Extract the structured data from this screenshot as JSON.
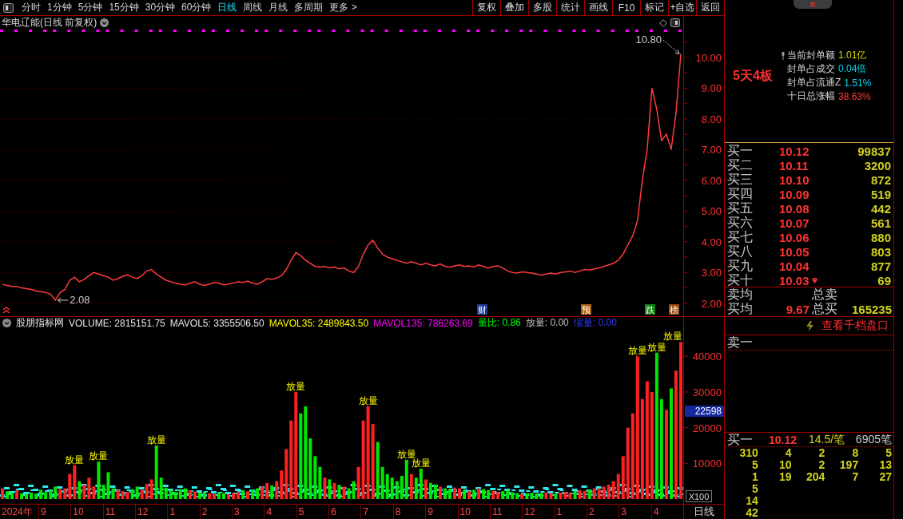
{
  "toolbar": {
    "period_tabs": [
      {
        "label": "分时",
        "selected": false
      },
      {
        "label": "1分钟",
        "selected": false
      },
      {
        "label": "5分钟",
        "selected": false
      },
      {
        "label": "15分钟",
        "selected": false
      },
      {
        "label": "30分钟",
        "selected": false
      },
      {
        "label": "60分钟",
        "selected": false
      },
      {
        "label": "日线",
        "selected": true
      },
      {
        "label": "周线",
        "selected": false
      },
      {
        "label": "月线",
        "selected": false
      },
      {
        "label": "多周期",
        "selected": false
      },
      {
        "label": "更多 >",
        "selected": false
      }
    ],
    "buttons": [
      "复权",
      "叠加",
      "多股",
      "统计",
      "画线",
      "F10",
      "标记",
      "+自选",
      "返回"
    ]
  },
  "price_chart": {
    "title": "华电辽能(日线 前复权)",
    "events": [
      {
        "text": "财",
        "color": "#1c3c9c"
      },
      {
        "text": "预",
        "color": "#b0600c"
      },
      {
        "text": "跌",
        "color": "#0a820a"
      },
      {
        "text": "榜",
        "color": "#9a4a10"
      }
    ],
    "chart_data": {
      "type": "line",
      "grid": true,
      "ylim": [
        1.58,
        10.83
      ],
      "yticks": [
        {
          "value": 2,
          "label": "2.00"
        },
        {
          "value": 3,
          "label": "3.00"
        },
        {
          "value": 4,
          "label": "4.00"
        },
        {
          "value": 5,
          "label": "5.00"
        },
        {
          "value": 6,
          "label": "6.00"
        },
        {
          "value": 7,
          "label": "7.00"
        },
        {
          "value": 8,
          "label": "8.00"
        },
        {
          "value": 9,
          "label": "9.00"
        },
        {
          "value": 10,
          "label": "10.00"
        }
      ],
      "categories": [
        null,
        null,
        null,
        null,
        null,
        null,
        null,
        null,
        null,
        null,
        null,
        null,
        null,
        null,
        null,
        null,
        null,
        null,
        null,
        null,
        null,
        null,
        null,
        null,
        null,
        null,
        null,
        null,
        null,
        null,
        null,
        null,
        null,
        null,
        null,
        null,
        null,
        null,
        null,
        null,
        null,
        null,
        null,
        null,
        null,
        null,
        null,
        null,
        null,
        null,
        null,
        null,
        null,
        null,
        null,
        null,
        null,
        null,
        null,
        null,
        null,
        null,
        null,
        null,
        null,
        null,
        null,
        null,
        null,
        null,
        null,
        null,
        null,
        null,
        null,
        null,
        null,
        null,
        null,
        null,
        null,
        null,
        null,
        null,
        null,
        null,
        null,
        null,
        null,
        null,
        null,
        null,
        null,
        null,
        null,
        null,
        null,
        null,
        null,
        null,
        null,
        null,
        null,
        null,
        null,
        null,
        null,
        null,
        null,
        null,
        null,
        null,
        null,
        null,
        null,
        null,
        null,
        null,
        null,
        null,
        null,
        null,
        null,
        null,
        null,
        null,
        null,
        null,
        null,
        null,
        null,
        null,
        null,
        null,
        null,
        null,
        null,
        null,
        null,
        null,
        null,
        null
      ],
      "series": [
        {
          "color": "#ff3b3b",
          "values": [
            2.62,
            2.58,
            2.55,
            2.55,
            2.5,
            2.48,
            2.45,
            2.4,
            2.38,
            2.35,
            2.3,
            2.1,
            2.35,
            2.45,
            2.75,
            2.85,
            2.7,
            2.78,
            2.9,
            3.0,
            2.95,
            2.9,
            2.85,
            2.75,
            2.8,
            2.88,
            2.92,
            2.85,
            2.8,
            2.9,
            3.05,
            3.1,
            2.95,
            2.85,
            2.75,
            2.7,
            2.65,
            2.62,
            2.6,
            2.65,
            2.7,
            2.62,
            2.58,
            2.62,
            2.68,
            2.65,
            2.6,
            2.62,
            2.66,
            2.7,
            2.68,
            2.72,
            2.65,
            2.62,
            2.7,
            2.8,
            2.78,
            2.82,
            2.9,
            3.1,
            3.4,
            3.65,
            3.55,
            3.4,
            3.3,
            3.2,
            3.18,
            3.2,
            3.15,
            3.18,
            3.12,
            3.15,
            3.05,
            3.0,
            3.2,
            3.6,
            3.9,
            4.05,
            3.8,
            3.6,
            3.5,
            3.45,
            3.4,
            3.35,
            3.3,
            3.35,
            3.3,
            3.25,
            3.3,
            3.25,
            3.22,
            3.28,
            3.2,
            3.18,
            3.22,
            3.25,
            3.2,
            3.22,
            3.18,
            3.25,
            3.2,
            3.15,
            3.2,
            3.22,
            3.15,
            3.05,
            3.0,
            2.98,
            3.02,
            3.0,
            2.98,
            2.95,
            2.92,
            2.95,
            2.98,
            2.95,
            3.0,
            3.02,
            3.05,
            3.0,
            3.05,
            3.1,
            3.08,
            3.12,
            3.15,
            3.2,
            3.25,
            3.3,
            3.4,
            3.6,
            3.9,
            4.2,
            4.7,
            6.0,
            7.0,
            9.0,
            8.3,
            7.3,
            7.5,
            7.0,
            8.2,
            10.12
          ]
        }
      ],
      "value_labels": [
        null,
        null,
        null,
        null,
        null,
        null,
        null,
        null,
        null,
        null,
        null,
        "2.08",
        null,
        null,
        null,
        null,
        null,
        null,
        null,
        null,
        null,
        null,
        null,
        null,
        null,
        null,
        null,
        null,
        null,
        null,
        null,
        null,
        null,
        null,
        null,
        null,
        null,
        null,
        null,
        null,
        null,
        null,
        null,
        null,
        null,
        null,
        null,
        null,
        null,
        null,
        null,
        null,
        null,
        null,
        null,
        null,
        null,
        null,
        null,
        null,
        null,
        null,
        null,
        null,
        null,
        null,
        null,
        null,
        null,
        null,
        null,
        null,
        null,
        null,
        null,
        null,
        null,
        null,
        null,
        null,
        null,
        null,
        null,
        null,
        null,
        null,
        null,
        null,
        null,
        null,
        null,
        null,
        null,
        null,
        null,
        null,
        null,
        null,
        null,
        null,
        null,
        null,
        null,
        null,
        null,
        null,
        null,
        null,
        null,
        null,
        null,
        null,
        null,
        null,
        null,
        null,
        null,
        null,
        null,
        null,
        null,
        null,
        null,
        null,
        null,
        null,
        null,
        null,
        null,
        null,
        null,
        null,
        null,
        null,
        null,
        null,
        null,
        null,
        null,
        null,
        null,
        "10.80"
      ]
    }
  },
  "volume_chart": {
    "indicator": "股朋指标网",
    "legend": [
      {
        "text": "VOLUME: 2815151.75",
        "color": "#e6e6e6"
      },
      {
        "text": "MAVOL5: 3355506.50",
        "color": "#e6e6e6"
      },
      {
        "text": "MAVOL35: 2489843.50",
        "color": "#ffff00"
      },
      {
        "text": "MAVOL135: 786263.69",
        "color": "#ff00ff"
      },
      {
        "text": "量比: 0.86",
        "color": "#00ff00"
      },
      {
        "text": "放量: 0.00",
        "color": "#c0c0c0"
      },
      {
        "text": "缩量: 0.00",
        "color": "#2f3cff"
      }
    ],
    "cursor_value": "22598",
    "unit": "X100",
    "chart_data": {
      "type": "bar",
      "ylim": [
        0,
        47650
      ],
      "yticks": [
        {
          "value": 10000,
          "label": "10000"
        },
        {
          "value": 20000,
          "label": "20000"
        },
        {
          "value": 30000,
          "label": "30000"
        },
        {
          "value": 40000,
          "label": "40000"
        }
      ],
      "categories": [
        null,
        null,
        null,
        null,
        null,
        null,
        null,
        null,
        null,
        null,
        null,
        null,
        null,
        null,
        null,
        null,
        null,
        null,
        null,
        null,
        null,
        null,
        null,
        null,
        null,
        null,
        null,
        null,
        null,
        null,
        null,
        null,
        null,
        null,
        null,
        null,
        null,
        null,
        null,
        null,
        null,
        null,
        null,
        null,
        null,
        null,
        null,
        null,
        null,
        null,
        null,
        null,
        null,
        null,
        null,
        null,
        null,
        null,
        null,
        null,
        null,
        null,
        null,
        null,
        null,
        null,
        null,
        null,
        null,
        null,
        null,
        null,
        null,
        null,
        null,
        null,
        null,
        null,
        null,
        null,
        null,
        null,
        null,
        null,
        null,
        null,
        null,
        null,
        null,
        null,
        null,
        null,
        null,
        null,
        null,
        null,
        null,
        null,
        null,
        null,
        null,
        null,
        null,
        null,
        null,
        null,
        null,
        null,
        null,
        null,
        null,
        null,
        null,
        null,
        null,
        null,
        null,
        null,
        null,
        null,
        null,
        null,
        null,
        null,
        null,
        null,
        null,
        null,
        null,
        null,
        null,
        null,
        null,
        null,
        null,
        null,
        null,
        null,
        null,
        null,
        null,
        null
      ],
      "series": [
        {
          "values": [
            3000,
            2200,
            1800,
            2500,
            1600,
            1400,
            1800,
            1500,
            2600,
            1900,
            2400,
            3500,
            2800,
            3000,
            7000,
            9500,
            5000,
            4000,
            6000,
            3500,
            10500,
            4000,
            7500,
            3000,
            2500,
            2200,
            2000,
            2800,
            3500,
            2600,
            4200,
            5500,
            15000,
            6000,
            3200,
            2500,
            2000,
            2800,
            3000,
            2400,
            2100,
            1800,
            2000,
            1600,
            1500,
            1900,
            1700,
            1400,
            1600,
            2000,
            2500,
            2200,
            2600,
            3000,
            3500,
            4500,
            3800,
            5000,
            8000,
            14000,
            22000,
            30000,
            24000,
            26000,
            17000,
            12000,
            9000,
            6000,
            5500,
            4500,
            4000,
            3500,
            3000,
            5000,
            9000,
            22000,
            26000,
            21000,
            16000,
            9000,
            7000,
            6000,
            5000,
            6500,
            11000,
            7000,
            6000,
            8500,
            5500,
            4500,
            4000,
            3500,
            3000,
            2800,
            3200,
            3000,
            2500,
            2200,
            2600,
            3000,
            2800,
            2500,
            2300,
            2000,
            2200,
            2400,
            1900,
            1700,
            1500,
            1600,
            1800,
            1500,
            1700,
            1900,
            1600,
            1500,
            1800,
            2000,
            1700,
            2200,
            2500,
            2300,
            2600,
            3000,
            2800,
            3500,
            4000,
            5000,
            7000,
            12000,
            20000,
            24000,
            40000,
            28000,
            33000,
            30000,
            41000,
            28000,
            25000,
            31000,
            36000,
            44000
          ]
        }
      ],
      "value_labels": [
        null,
        null,
        null,
        null,
        null,
        null,
        null,
        null,
        null,
        null,
        null,
        null,
        null,
        null,
        null,
        "放量",
        null,
        null,
        null,
        null,
        "放量",
        null,
        null,
        null,
        null,
        null,
        null,
        null,
        null,
        null,
        null,
        null,
        "放量",
        null,
        null,
        null,
        null,
        null,
        null,
        null,
        null,
        null,
        null,
        null,
        null,
        null,
        null,
        null,
        null,
        null,
        null,
        null,
        null,
        null,
        null,
        null,
        null,
        null,
        null,
        null,
        null,
        "放量",
        null,
        null,
        null,
        null,
        null,
        null,
        null,
        null,
        null,
        null,
        null,
        null,
        null,
        null,
        "放量",
        null,
        null,
        null,
        null,
        null,
        null,
        null,
        "放量",
        null,
        null,
        "放量",
        null,
        null,
        null,
        null,
        null,
        null,
        null,
        null,
        null,
        null,
        null,
        null,
        null,
        null,
        null,
        null,
        null,
        null,
        null,
        null,
        null,
        null,
        null,
        null,
        null,
        null,
        null,
        null,
        null,
        null,
        null,
        null,
        null,
        null,
        null,
        null,
        null,
        null,
        null,
        null,
        null,
        null,
        null,
        null,
        "放量",
        null,
        null,
        null,
        "放量",
        null,
        null,
        null,
        null,
        "放量"
      ]
    }
  },
  "time_axis": {
    "labels": [
      "2024年",
      "9",
      "10",
      "11",
      "12",
      "1",
      "2",
      "3",
      "4",
      "5",
      "6",
      "7",
      "8",
      "9",
      "10",
      "11",
      "12",
      "1",
      "2",
      "3",
      "4"
    ],
    "period": "日线"
  },
  "quote_panel": {
    "badge": "5天4板",
    "stats": [
      {
        "label": "当前封单额",
        "value": "1.01亿",
        "color": "#d8d800",
        "pinned": true
      },
      {
        "label": "封单占成交",
        "value": "0.04倍",
        "color": "#00d8f0",
        "pinned": false
      },
      {
        "label": "封单占流通Z",
        "value": "1.51%",
        "color": "#00d8f0",
        "pinned": false
      },
      {
        "label": "十日总涨幅",
        "value": "38.63%",
        "color": "#ff3c3c",
        "pinned": false
      }
    ],
    "bids": [
      {
        "label": "买一",
        "price": "10.12",
        "volume": "99837",
        "marked": false
      },
      {
        "label": "买二",
        "price": "10.11",
        "volume": "3200",
        "marked": false
      },
      {
        "label": "买三",
        "price": "10.10",
        "volume": "872",
        "marked": false
      },
      {
        "label": "买四",
        "price": "10.09",
        "volume": "519",
        "marked": false
      },
      {
        "label": "买五",
        "price": "10.08",
        "volume": "442",
        "marked": false
      },
      {
        "label": "买六",
        "price": "10.07",
        "volume": "561",
        "marked": false
      },
      {
        "label": "买七",
        "price": "10.06",
        "volume": "880",
        "marked": false
      },
      {
        "label": "买八",
        "price": "10.05",
        "volume": "803",
        "marked": false
      },
      {
        "label": "买九",
        "price": "10.04",
        "volume": "877",
        "marked": false
      },
      {
        "label": "买十",
        "price": "10.03",
        "volume": "69",
        "marked": true
      }
    ],
    "ask_avg": {
      "label": "卖均",
      "total_label": "总卖"
    },
    "bid_avg": {
      "label": "买均",
      "price": "9.67",
      "total_label": "总买",
      "total": "165235"
    },
    "depth_link": "查看千档盘口",
    "best_ask": {
      "label": "卖一"
    },
    "best_bid": {
      "label": "买一",
      "price": "10.12",
      "per_trade": "14.5/笔",
      "count": "6905笔"
    },
    "ticks": [
      [
        "310",
        "4",
        "2",
        "8",
        "5"
      ],
      [
        "5",
        "10",
        "2",
        "197",
        "13"
      ],
      [
        "1",
        "19",
        "204",
        "7",
        "27"
      ],
      [
        "5"
      ],
      [
        "14"
      ],
      [
        "42"
      ]
    ]
  }
}
